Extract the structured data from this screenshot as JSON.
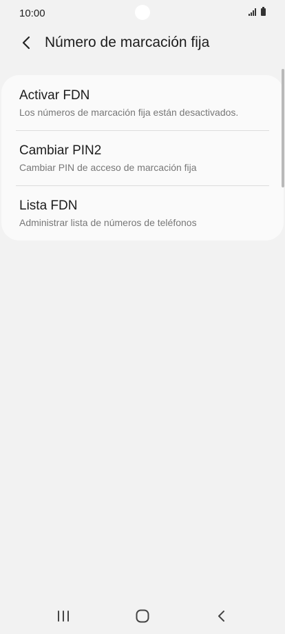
{
  "status_bar": {
    "time": "10:00"
  },
  "header": {
    "back_icon": "chevron-left-icon",
    "title": "Número de marcación fija"
  },
  "settings": {
    "items": [
      {
        "title": "Activar FDN",
        "subtitle": "Los números de marcación fija están desactivados."
      },
      {
        "title": "Cambiar PIN2",
        "subtitle": "Cambiar PIN de acceso de marcación fija"
      },
      {
        "title": "Lista FDN",
        "subtitle": "Administrar lista de números de teléfonos"
      }
    ]
  },
  "nav_bar": {
    "recents_icon": "recents-icon",
    "home_icon": "home-icon",
    "back_icon": "back-icon"
  },
  "colors": {
    "background": "#f2f2f2",
    "card": "#fafafa",
    "text_primary": "#1c1c1c",
    "text_secondary": "#777777"
  }
}
